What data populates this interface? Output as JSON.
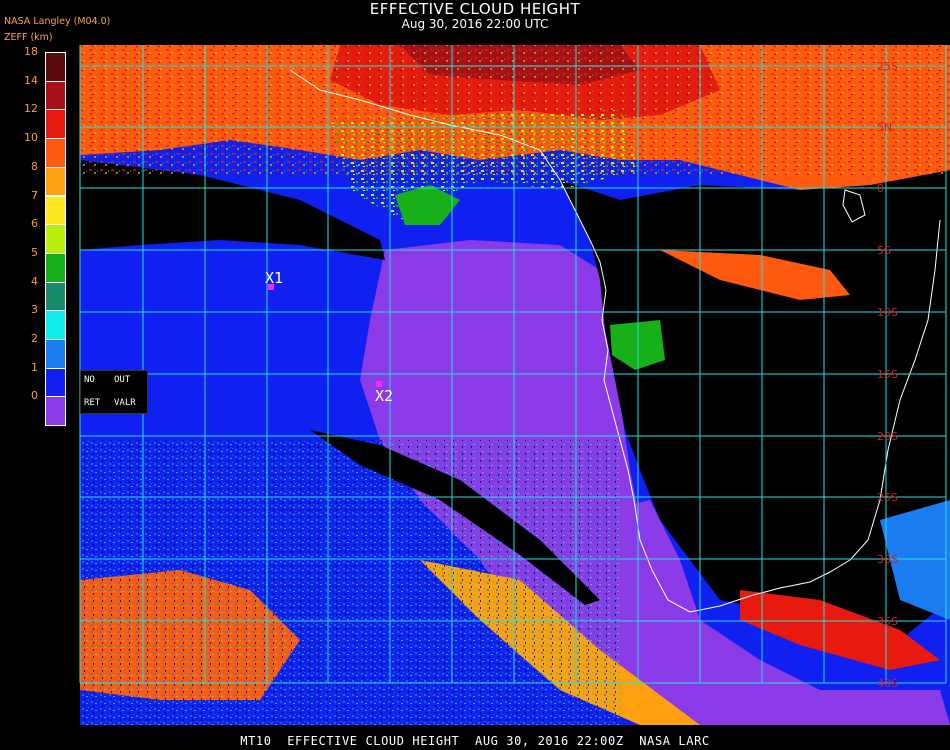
{
  "header": {
    "title": "EFFECTIVE CLOUD HEIGHT",
    "subtitle": "Aug 30, 2016 22:00 UTC",
    "org": "NASA Langley (M04.0)",
    "param": "ZEFF (km)"
  },
  "legend": {
    "ticks": [
      "18",
      "14",
      "12",
      "10",
      "8",
      "7",
      "6",
      "5",
      "4",
      "3",
      "2",
      "1",
      "0"
    ],
    "colors": [
      "#5a0a0a",
      "#a81018",
      "#e81a10",
      "#ff5a10",
      "#ffa010",
      "#ffe820",
      "#b8ee10",
      "#18b018",
      "#1a8a6a",
      "#10ecec",
      "#1a7cf0",
      "#1020f0",
      "#8a3ae6"
    ],
    "no_retrieval": [
      "NO",
      "RET"
    ],
    "out_of_range": [
      "OUT",
      "VALR"
    ]
  },
  "map": {
    "lat_labels": [
      "25S",
      "5N",
      "0",
      "5S",
      "10S",
      "15S",
      "20S",
      "25S",
      "30S",
      "35S",
      "40S"
    ],
    "markers": [
      {
        "label": "X1",
        "color": "#ff22ff"
      },
      {
        "label": "X2",
        "color": "#ff22ff"
      }
    ],
    "grid_color": "#22e0e0",
    "coast_color": "#ffffff"
  },
  "footer": "MT10  EFFECTIVE CLOUD HEIGHT  AUG 30, 2016 22:00Z  NASA LARC"
}
